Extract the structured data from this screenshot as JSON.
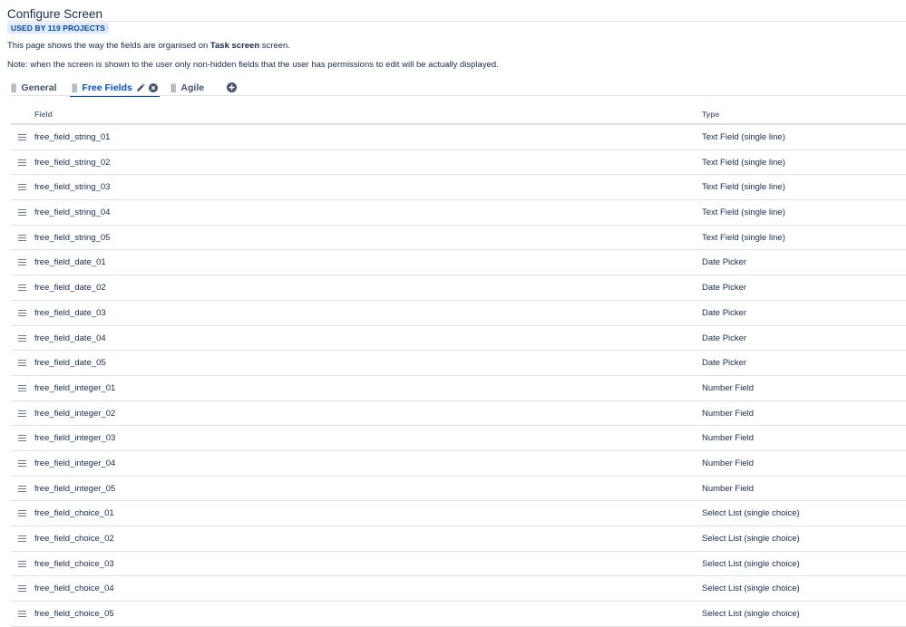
{
  "page": {
    "title": "Configure Screen",
    "badge": "USED BY 119 PROJECTS",
    "description_prefix": "This page shows the way the fields are organised on ",
    "description_screen_name": "Task screen",
    "description_suffix": " screen.",
    "note": "Note: when the screen is shown to the user only non-hidden fields that the user has permissions to edit will be actually displayed."
  },
  "tabs": [
    {
      "label": "General",
      "active": false
    },
    {
      "label": "Free Fields",
      "active": true
    },
    {
      "label": "Agile",
      "active": false
    }
  ],
  "table": {
    "headers": {
      "field": "Field",
      "type": "Type"
    },
    "rows": [
      {
        "name": "free_field_string_01",
        "type": "Text Field (single line)"
      },
      {
        "name": "free_field_string_02",
        "type": "Text Field (single line)"
      },
      {
        "name": "free_field_string_03",
        "type": "Text Field (single line)"
      },
      {
        "name": "free_field_string_04",
        "type": "Text Field (single line)"
      },
      {
        "name": "free_field_string_05",
        "type": "Text Field (single line)"
      },
      {
        "name": "free_field_date_01",
        "type": "Date Picker"
      },
      {
        "name": "free_field_date_02",
        "type": "Date Picker"
      },
      {
        "name": "free_field_date_03",
        "type": "Date Picker"
      },
      {
        "name": "free_field_date_04",
        "type": "Date Picker"
      },
      {
        "name": "free_field_date_05",
        "type": "Date Picker"
      },
      {
        "name": "free_field_integer_01",
        "type": "Number Field"
      },
      {
        "name": "free_field_integer_02",
        "type": "Number Field"
      },
      {
        "name": "free_field_integer_03",
        "type": "Number Field"
      },
      {
        "name": "free_field_integer_04",
        "type": "Number Field"
      },
      {
        "name": "free_field_integer_05",
        "type": "Number Field"
      },
      {
        "name": "free_field_choice_01",
        "type": "Select List (single choice)"
      },
      {
        "name": "free_field_choice_02",
        "type": "Select List (single choice)"
      },
      {
        "name": "free_field_choice_03",
        "type": "Select List (single choice)"
      },
      {
        "name": "free_field_choice_04",
        "type": "Select List (single choice)"
      },
      {
        "name": "free_field_choice_05",
        "type": "Select List (single choice)"
      }
    ]
  },
  "icons": {
    "tab_grip": "drag-handle-icon",
    "edit": "pencil-icon",
    "remove_tab": "close-circle-icon",
    "add_tab": "plus-circle-icon",
    "row_drag": "hamburger-drag-icon"
  },
  "colors": {
    "accent": "#0052cc",
    "badge_bg": "#deebff",
    "badge_text": "#0747a6",
    "text": "#172b4d",
    "border": "#dfe1e6"
  }
}
